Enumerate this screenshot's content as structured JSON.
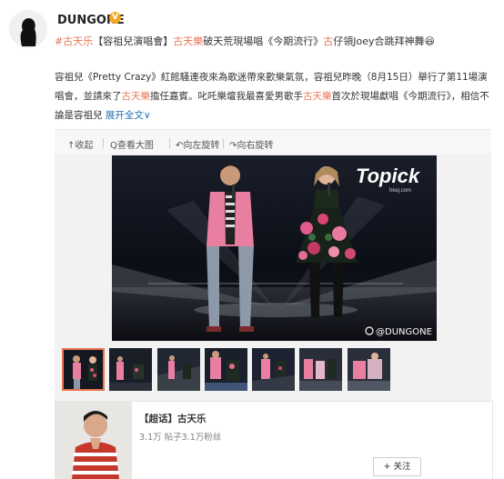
{
  "post": {
    "author": "DUNGONE",
    "verified_badge": "V",
    "headline_parts": [
      {
        "text": "#古天乐",
        "style": "link"
      },
      {
        "text": "【容祖兒演唱會】",
        "style": "plain"
      },
      {
        "text": "古天樂",
        "style": "link"
      },
      {
        "text": "破天荒現場唱《今期流行》",
        "style": "plain"
      },
      {
        "text": "古",
        "style": "link"
      },
      {
        "text": "仔領Joey合跳拜神舞",
        "style": "plain"
      },
      {
        "text": "😆",
        "style": "plain"
      }
    ],
    "body_parts": [
      {
        "text": "容祖兒《Pretty Crazy》紅館騷連夜來為歌迷帶來歡樂氣氛，容祖兒昨晚（8月15日）舉行了第11場演唱會，並請來了",
        "style": "plain"
      },
      {
        "text": "古天樂",
        "style": "link"
      },
      {
        "text": "擔任嘉賓。叱吒樂壇我最喜愛男歌手",
        "style": "plain"
      },
      {
        "text": "古天樂",
        "style": "link"
      },
      {
        "text": "首次於現場獻唱《今期流行》，相信不論是容祖兒 ",
        "style": "plain"
      },
      {
        "text": "展开全文",
        "style": "blue"
      },
      {
        "text": "∨",
        "style": "blue"
      }
    ]
  },
  "toolbar": {
    "collapse": "↑收起",
    "view_large": "Q查看大图",
    "rotate_left": "↶向左旋转",
    "rotate_right": "↷向右旋转"
  },
  "photo": {
    "logo_text": "Topick",
    "logo_sub": "hkej.com",
    "watermark": "@DUNGONE"
  },
  "thumbnails": [
    {
      "name": "thumb-1",
      "selected": true
    },
    {
      "name": "thumb-2",
      "selected": false
    },
    {
      "name": "thumb-3",
      "selected": false
    },
    {
      "name": "thumb-4",
      "selected": false
    },
    {
      "name": "thumb-5",
      "selected": false
    },
    {
      "name": "thumb-6",
      "selected": false
    },
    {
      "name": "thumb-7",
      "selected": false
    }
  ],
  "topic": {
    "title": "【超话】古天乐",
    "stats": "3.1万  帖子3.1万粉丝",
    "follow_label": "+ 关注"
  },
  "colors": {
    "accent": "#eb7350",
    "link_blue": "#1f6fb2",
    "badge": "#f5a623"
  }
}
